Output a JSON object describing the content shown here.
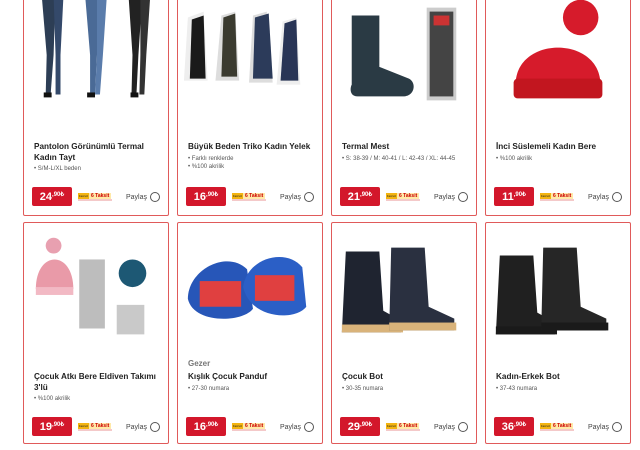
{
  "products": [
    {
      "brand": "",
      "title": "Pantolon Görünümlü Termal Kadın Tayt",
      "features": [
        "S/M-L/XL beden"
      ],
      "price_main": "24",
      "price_dec": ",90",
      "currency": "₺",
      "share": "Paylaş",
      "installment_a": "Faizsiz",
      "installment_b": "6 Taksit",
      "image": "leggings-image"
    },
    {
      "brand": "",
      "title": "Büyük Beden Triko Kadın Yelek",
      "features": [
        "Farklı renklerde",
        "%100 akrilik"
      ],
      "price_main": "16",
      "price_dec": ",90",
      "currency": "₺",
      "share": "Paylaş",
      "installment_a": "Faizsiz",
      "installment_b": "6 Taksit",
      "image": "vest-image"
    },
    {
      "brand": "",
      "title": "Termal Mest",
      "features": [
        "S: 38-39 / M: 40-41 / L: 42-43 / XL: 44-45"
      ],
      "price_main": "21",
      "price_dec": ",90",
      "currency": "₺",
      "share": "Paylaş",
      "installment_a": "Faizsiz",
      "installment_b": "6 Taksit",
      "image": "sock-image"
    },
    {
      "brand": "",
      "title": "İnci Süslemeli Kadın Bere",
      "features": [
        "%100 akrilik"
      ],
      "price_main": "11",
      "price_dec": ",90",
      "currency": "₺",
      "share": "Paylaş",
      "installment_a": "Faizsiz",
      "installment_b": "6 Taksit",
      "image": "beanie-image"
    },
    {
      "brand": "",
      "title": "Çocuk Atkı Bere Eldiven Takımı 3'lü",
      "features": [
        "%100 akrilik"
      ],
      "price_main": "19",
      "price_dec": ",90",
      "currency": "₺",
      "share": "Paylaş",
      "installment_a": "Faizsiz",
      "installment_b": "6 Taksit",
      "image": "kids-set-image"
    },
    {
      "brand": "Gezer",
      "title": "Kışlık Çocuk Panduf",
      "features": [
        "27-30 numara"
      ],
      "price_main": "16",
      "price_dec": ",90",
      "currency": "₺",
      "share": "Paylaş",
      "installment_a": "Faizsiz",
      "installment_b": "6 Taksit",
      "image": "slipper-image"
    },
    {
      "brand": "",
      "title": "Çocuk Bot",
      "features": [
        "30-35 numara"
      ],
      "price_main": "29",
      "price_dec": ",90",
      "currency": "₺",
      "share": "Paylaş",
      "installment_a": "Faizsiz",
      "installment_b": "6 Taksit",
      "image": "kids-boot-image"
    },
    {
      "brand": "",
      "title": "Kadın-Erkek Bot",
      "features": [
        "37-43 numara"
      ],
      "price_main": "36",
      "price_dec": ",90",
      "currency": "₺",
      "share": "Paylaş",
      "installment_a": "Faizsiz",
      "installment_b": "6 Taksit",
      "image": "boot-image"
    }
  ],
  "colors": {
    "accent": "#d3172b",
    "border": "#e05a5a",
    "installment": "#f3b411"
  }
}
